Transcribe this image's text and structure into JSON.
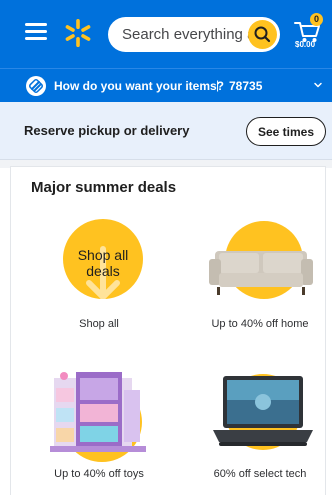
{
  "header": {
    "search_placeholder": "Search everything a",
    "cart_count": "0",
    "cart_total": "$0.00"
  },
  "delivery_bar": {
    "question": "How do you want your items?",
    "separator": "|",
    "zip": "78735"
  },
  "pickup_banner": {
    "text": "Reserve pickup or delivery",
    "button_label": "See times"
  },
  "deals": {
    "title": "Major summer deals",
    "tiles": [
      {
        "label": "Shop all",
        "image_text_line1": "Shop all",
        "image_text_line2": "deals"
      },
      {
        "label": "Up to 40% off home"
      },
      {
        "label": "Up to 40% off toys"
      },
      {
        "label": "60% off select tech"
      }
    ]
  },
  "colors": {
    "brand_blue": "#0071dc",
    "spark_yellow": "#ffc220",
    "banner_bg": "#e8f0fb"
  },
  "icons": {
    "menu": "hamburger-icon",
    "logo": "walmart-spark-icon",
    "search": "search-icon",
    "cart": "cart-icon",
    "delivery": "delivery-options-icon",
    "chevron": "chevron-down-icon"
  }
}
